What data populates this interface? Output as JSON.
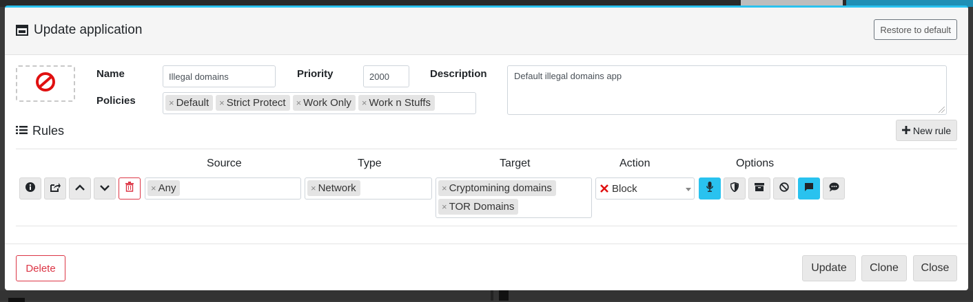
{
  "modal": {
    "title": "Update application",
    "restore_label": "Restore to default"
  },
  "form": {
    "name_label": "Name",
    "name_value": "Illegal domains",
    "priority_label": "Priority",
    "priority_value": "2000",
    "description_label": "Description",
    "description_value": "Default illegal domains app",
    "policies_label": "Policies",
    "policies": [
      "Default",
      "Strict Protect",
      "Work Only",
      "Work n Stuffs"
    ]
  },
  "rules": {
    "title": "Rules",
    "new_rule_label": "New rule",
    "columns": {
      "source": "Source",
      "type": "Type",
      "target": "Target",
      "action": "Action",
      "options": "Options"
    },
    "row": {
      "source_tags": [
        "Any"
      ],
      "type_tags": [
        "Network"
      ],
      "target_tags": [
        "Cryptomining domains",
        "TOR Domains"
      ],
      "action_value": "Block"
    }
  },
  "footer": {
    "delete_label": "Delete",
    "update_label": "Update",
    "clone_label": "Clone",
    "close_label": "Close"
  },
  "colors": {
    "accent": "#29c2ef",
    "danger": "#dc3545"
  }
}
